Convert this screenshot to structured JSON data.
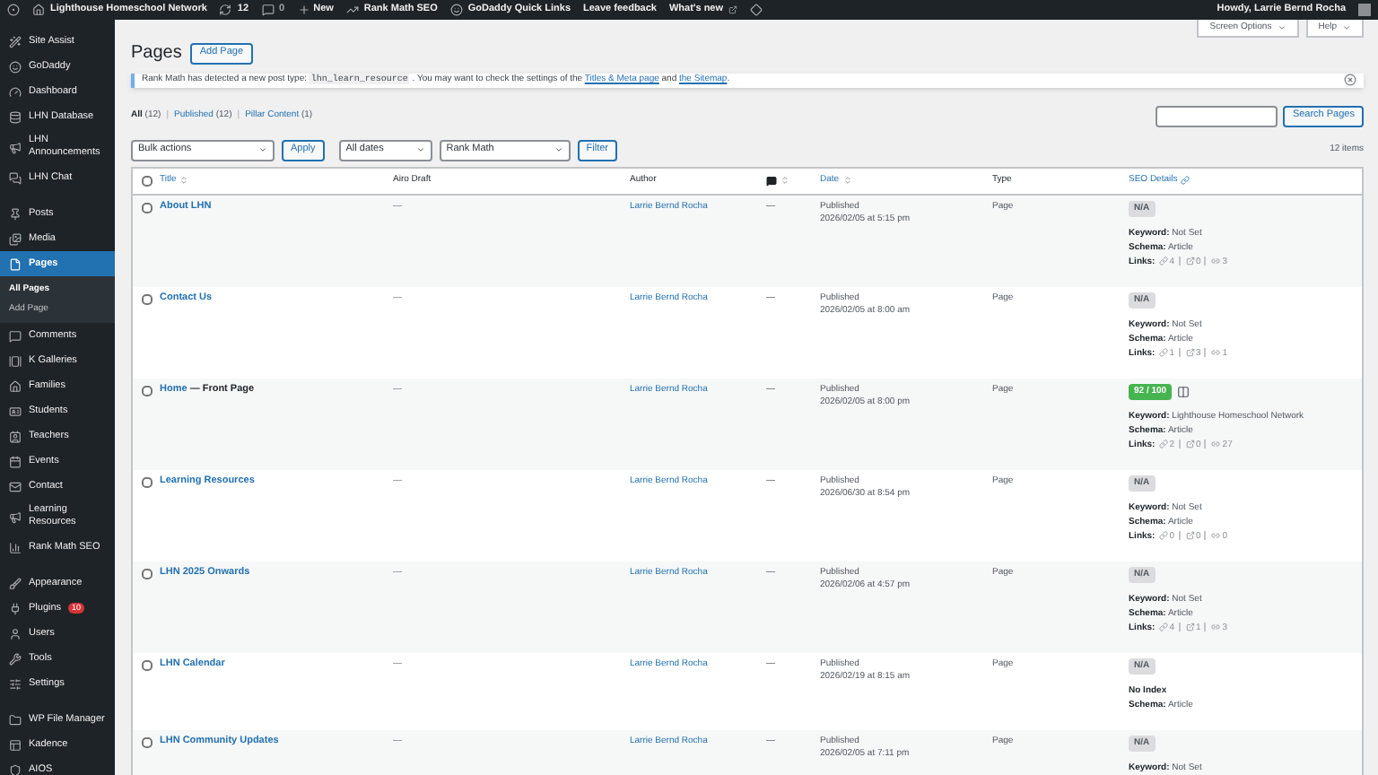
{
  "admin_bar": {
    "site": "Lighthouse Homeschool Network",
    "updates": "12",
    "comments": "0",
    "new": "New",
    "items": [
      "Rank Math SEO",
      "GoDaddy Quick Links",
      "Leave feedback",
      "What's new"
    ],
    "greeting": "Howdy, Larrie Bernd Rocha"
  },
  "sidebar": {
    "items": [
      {
        "label": "Site Assist",
        "selected": false
      },
      {
        "label": "GoDaddy",
        "selected": false
      },
      {
        "label": "Dashboard",
        "selected": false
      },
      {
        "label": "LHN Database",
        "selected": false
      },
      {
        "label": "LHN Announcements",
        "selected": false
      },
      {
        "label": "LHN Chat",
        "selected": false
      },
      {
        "label": "Posts",
        "selected": false
      },
      {
        "label": "Media",
        "selected": false
      },
      {
        "label": "Pages",
        "selected": true,
        "children": [
          {
            "label": "All Pages",
            "selected": true
          },
          {
            "label": "Add Page",
            "selected": false
          }
        ]
      },
      {
        "label": "Comments",
        "selected": false
      },
      {
        "label": "K Galleries",
        "selected": false
      },
      {
        "label": "Families",
        "selected": false
      },
      {
        "label": "Students",
        "selected": false
      },
      {
        "label": "Teachers",
        "selected": false
      },
      {
        "label": "Events",
        "selected": false
      },
      {
        "label": "Contact",
        "selected": false
      },
      {
        "label": "Learning Resources",
        "selected": false
      },
      {
        "label": "Rank Math SEO",
        "selected": false
      },
      {
        "label": "Appearance",
        "selected": false
      },
      {
        "label": "Plugins",
        "selected": false,
        "badge": "10"
      },
      {
        "label": "Users",
        "selected": false
      },
      {
        "label": "Tools",
        "selected": false
      },
      {
        "label": "Settings",
        "selected": false
      },
      {
        "label": "WP File Manager",
        "selected": false
      },
      {
        "label": "Kadence",
        "selected": false
      },
      {
        "label": "AIOS",
        "selected": false
      }
    ]
  },
  "top_buttons": [
    "Screen Options",
    "Help"
  ],
  "title": "Pages",
  "add_button": "Add Page",
  "notice": [
    {
      "kind": "text",
      "text": "Rank Math has detected a new post type: "
    },
    {
      "kind": "code",
      "text": "lhn_learn_resource"
    },
    {
      "kind": "text",
      "text": " . You may want to check the settings of the "
    },
    {
      "kind": "link",
      "text": "Titles & Meta page"
    },
    {
      "kind": "text",
      "text": " and "
    },
    {
      "kind": "link",
      "text": "the Sitemap"
    },
    {
      "kind": "text",
      "text": "."
    }
  ],
  "views": [
    {
      "label": "All",
      "count": "(12)",
      "selected": true
    },
    {
      "label": "Published",
      "count": "(12)",
      "selected": false
    },
    {
      "label": "Pillar Content",
      "count": "(1)",
      "selected": false
    }
  ],
  "view_separator": "|",
  "search_button": "Search Pages",
  "bulk_actions": "Bulk actions",
  "apply": "Apply",
  "dates": "All dates",
  "rank_filter": "Rank Math",
  "filter": "Filter",
  "item_count": "12 items",
  "select_all_checked": false,
  "columns": [
    {
      "label": "Title",
      "kind": "sort"
    },
    {
      "label": "Airo Draft",
      "kind": "plain"
    },
    {
      "label": "Author",
      "kind": "plain"
    },
    {
      "kind": "comments"
    },
    {
      "label": "Date",
      "kind": "sort"
    },
    {
      "label": "Type",
      "kind": "plain"
    },
    {
      "label": "SEO Details",
      "kind": "link"
    }
  ],
  "rows": [
    {
      "checked": false,
      "title": "About LHN",
      "airo": "—",
      "author": "Larrie Bernd Rocha",
      "comments": "—",
      "status": "Published",
      "date": "2026/02/05 at 5:15 pm",
      "type": "Page",
      "seo": {
        "score": "N/A",
        "good": false,
        "pillar": false,
        "lines": [
          {
            "label": "Keyword:",
            "value": "Not Set"
          },
          {
            "label": "Schema:",
            "value": "Article"
          }
        ],
        "links_label": "Links:",
        "links": [
          "4",
          "0",
          "3"
        ]
      }
    },
    {
      "checked": false,
      "title": "Contact Us",
      "airo": "—",
      "author": "Larrie Bernd Rocha",
      "comments": "—",
      "status": "Published",
      "date": "2026/02/05 at 8:00 am",
      "type": "Page",
      "seo": {
        "score": "N/A",
        "good": false,
        "pillar": false,
        "lines": [
          {
            "label": "Keyword:",
            "value": "Not Set"
          },
          {
            "label": "Schema:",
            "value": "Article"
          }
        ],
        "links_label": "Links:",
        "links": [
          "1",
          "3",
          "1"
        ]
      }
    },
    {
      "checked": false,
      "title": "Home",
      "state": "— Front Page",
      "airo": "—",
      "author": "Larrie Bernd Rocha",
      "comments": "—",
      "status": "Published",
      "date": "2026/02/05 at 8:00 pm",
      "type": "Page",
      "seo": {
        "score": "92 / 100",
        "good": true,
        "pillar": true,
        "lines": [
          {
            "label": "Keyword:",
            "value": "Lighthouse Homeschool Network"
          },
          {
            "label": "Schema:",
            "value": "Article"
          }
        ],
        "links_label": "Links:",
        "links": [
          "2",
          "0",
          "27"
        ]
      }
    },
    {
      "checked": false,
      "title": "Learning Resources",
      "airo": "—",
      "author": "Larrie Bernd Rocha",
      "comments": "—",
      "status": "Published",
      "date": "2026/06/30 at 8:54 pm",
      "type": "Page",
      "seo": {
        "score": "N/A",
        "good": false,
        "pillar": false,
        "lines": [
          {
            "label": "Keyword:",
            "value": "Not Set"
          },
          {
            "label": "Schema:",
            "value": "Article"
          }
        ],
        "links_label": "Links:",
        "links": [
          "0",
          "0",
          "0"
        ]
      }
    },
    {
      "checked": false,
      "title": "LHN 2025 Onwards",
      "airo": "—",
      "author": "Larrie Bernd Rocha",
      "comments": "—",
      "status": "Published",
      "date": "2026/02/06 at 4:57 pm",
      "type": "Page",
      "seo": {
        "score": "N/A",
        "good": false,
        "pillar": false,
        "lines": [
          {
            "label": "Keyword:",
            "value": "Not Set"
          },
          {
            "label": "Schema:",
            "value": "Article"
          }
        ],
        "links_label": "Links:",
        "links": [
          "4",
          "1",
          "3"
        ]
      }
    },
    {
      "checked": false,
      "title": "LHN Calendar",
      "airo": "—",
      "author": "Larrie Bernd Rocha",
      "comments": "—",
      "status": "Published",
      "date": "2026/02/19 at 8:15 am",
      "type": "Page",
      "seo": {
        "score": "N/A",
        "good": false,
        "pillar": false,
        "lines": [
          {
            "label": "No Index"
          },
          {
            "label": "Schema:",
            "value": "Article"
          }
        ]
      }
    },
    {
      "checked": false,
      "title": "LHN Community Updates",
      "airo": "—",
      "author": "Larrie Bernd Rocha",
      "comments": "—",
      "status": "Published",
      "date": "2026/02/05 at 7:11 pm",
      "type": "Page",
      "seo": {
        "score": "N/A",
        "good": false,
        "pillar": false,
        "lines": [
          {
            "label": "Keyword:",
            "value": "Not Set"
          }
        ]
      }
    }
  ]
}
